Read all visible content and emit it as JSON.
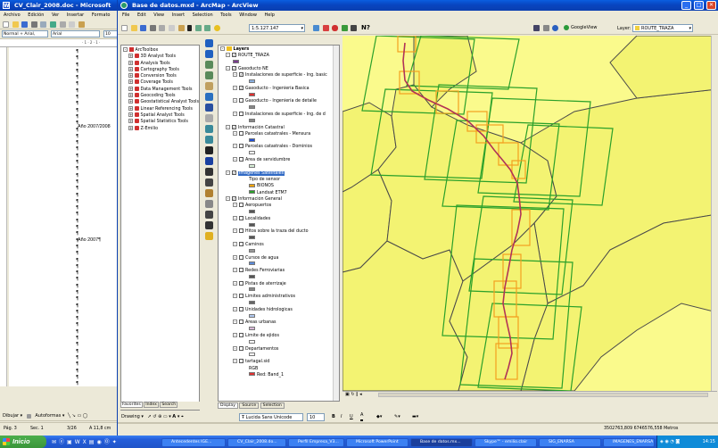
{
  "word": {
    "title": "CV_Clair_2008.doc - Microsoft Word",
    "menu": [
      "Archivo",
      "Edición",
      "Ver",
      "Insertar",
      "Formato"
    ],
    "style_box": "Normal + Arial,",
    "font_box": "Arial",
    "size_box": "10",
    "doc_text": [
      "Año 2007/2008",
      "Año 2007¶"
    ],
    "status": [
      "Pág. 3",
      "Sec. 1",
      "3/26",
      "A 11,8 cm"
    ],
    "draw_label": "Dibujar ▾",
    "autoshapes_label": "Autoformas ▾",
    "ruler_text": "· 1 · 2 · 1 ·"
  },
  "arcmap": {
    "title": "Base de datos.mxd - ArcMap - ArcView",
    "menu": [
      "File",
      "Edit",
      "View",
      "Insert",
      "Selection",
      "Tools",
      "Window",
      "Help"
    ],
    "scale": "1:5.127.147",
    "googleview": "GoogleView",
    "layer_label": "Layer:",
    "layer_value": "ROUTE_TRAZA",
    "toolbox": {
      "root": "ArcToolbox",
      "items": [
        "3D Analyst Tools",
        "Analysis Tools",
        "Cartography Tools",
        "Conversion Tools",
        "Coverage Tools",
        "Data Management Tools",
        "Geocoding Tools",
        "Geostatistical Analyst Tools",
        "Linear Referencing Tools",
        "Spatial Analyst Tools",
        "Spatial Statistics Tools",
        "Z-Emilio"
      ],
      "tabs": [
        "Favorites",
        "Index",
        "Search"
      ]
    },
    "toc": {
      "root": "Layers",
      "rows": [
        {
          "t": "ROUTE_TRAZA",
          "lvl": 1,
          "cb": true,
          "pm": "-"
        },
        {
          "t": "",
          "lvl": 2,
          "sw": "#7a3b8f"
        },
        {
          "t": "Gasoducto NE",
          "lvl": 1,
          "cb": true,
          "pm": "-"
        },
        {
          "t": "Instalaciones de superficie - Ing. basic",
          "lvl": 2,
          "cb": true,
          "pm": "-"
        },
        {
          "t": "",
          "lvl": 3,
          "sw": "#8ab0e0"
        },
        {
          "t": "Gasoducto - Ingeniería Basica",
          "lvl": 2,
          "cb": true,
          "pm": "-"
        },
        {
          "t": "",
          "lvl": 3,
          "sw": "#e03030"
        },
        {
          "t": "Gasoducto - Ingeniería de detalle",
          "lvl": 2,
          "cb": false,
          "pm": "-"
        },
        {
          "t": "",
          "lvl": 3,
          "sw": "#888888"
        },
        {
          "t": "Instalaciones de superficie - Ing. de d",
          "lvl": 2,
          "cb": false,
          "pm": "-"
        },
        {
          "t": "",
          "lvl": 3,
          "sw": "#888888"
        },
        {
          "t": "Información Catastral",
          "lvl": 1,
          "cb": true,
          "pm": "-"
        },
        {
          "t": "Parcelas catastrales - Mensura",
          "lvl": 2,
          "cb": false,
          "pm": "-"
        },
        {
          "t": "",
          "lvl": 3,
          "sw": "#1f4fd6"
        },
        {
          "t": "Parcelas catastrales - Dominios",
          "lvl": 2,
          "cb": false,
          "pm": "-"
        },
        {
          "t": "",
          "lvl": 3,
          "sw": "#ffffff"
        },
        {
          "t": "Area de servidumbre",
          "lvl": 2,
          "cb": false,
          "pm": "-"
        },
        {
          "t": "",
          "lvl": 3,
          "sw": "#d8f0d8"
        },
        {
          "t": "Imágenes Satelitales",
          "lvl": 1,
          "cb": true,
          "pm": "-",
          "sel": true
        },
        {
          "t": "Tipo de sensor",
          "lvl": 3
        },
        {
          "t": "BIONOS",
          "lvl": 3,
          "sw": "#ffa500"
        },
        {
          "t": "Landsat ETM7",
          "lvl": 3,
          "sw": "#2aa02a"
        },
        {
          "t": "Información General",
          "lvl": 1,
          "cb": true,
          "pm": "-"
        },
        {
          "t": "Aeropuertos",
          "lvl": 2,
          "cb": false,
          "pm": "-"
        },
        {
          "t": "",
          "lvl": 3,
          "sw": "#555555"
        },
        {
          "t": "Localidades",
          "lvl": 2,
          "cb": false,
          "pm": "-"
        },
        {
          "t": "",
          "lvl": 3,
          "sw": "#555555"
        },
        {
          "t": "Hitos sobre la traza del ducto",
          "lvl": 2,
          "cb": false,
          "pm": "-"
        },
        {
          "t": "",
          "lvl": 3,
          "sw": "#555555"
        },
        {
          "t": "Caminos",
          "lvl": 2,
          "cb": false,
          "pm": "-"
        },
        {
          "t": "",
          "lvl": 3,
          "sw": "#999999"
        },
        {
          "t": "Cursos de agua",
          "lvl": 2,
          "cb": false,
          "pm": "-"
        },
        {
          "t": "",
          "lvl": 3,
          "sw": "#5a8ad8"
        },
        {
          "t": "Redes Ferroviarias",
          "lvl": 2,
          "cb": false,
          "pm": "-"
        },
        {
          "t": "",
          "lvl": 3,
          "sw": "#555555"
        },
        {
          "t": "Pistas de aterrizaje",
          "lvl": 2,
          "cb": false,
          "pm": "-"
        },
        {
          "t": "",
          "lvl": 3,
          "sw": "#888888"
        },
        {
          "t": "Limites administrativos",
          "lvl": 2,
          "cb": false,
          "pm": "-"
        },
        {
          "t": "",
          "lvl": 3,
          "sw": "#666666"
        },
        {
          "t": "Unidades hidrologicas",
          "lvl": 2,
          "cb": false,
          "pm": "-"
        },
        {
          "t": "",
          "lvl": 3,
          "sw": "#b0c8f0"
        },
        {
          "t": "Areas urbanas",
          "lvl": 2,
          "cb": false,
          "pm": "-"
        },
        {
          "t": "",
          "lvl": 3,
          "sw": "#d8b8d8"
        },
        {
          "t": "Limite de ejidos",
          "lvl": 2,
          "cb": false,
          "pm": "-"
        },
        {
          "t": "",
          "lvl": 3,
          "sw": "#ffffff"
        },
        {
          "t": "Departamentos",
          "lvl": 2,
          "cb": false,
          "pm": "-"
        },
        {
          "t": "",
          "lvl": 3,
          "sw": "#ffffff"
        },
        {
          "t": "tartagal.sid",
          "lvl": 2,
          "cb": false,
          "pm": "-"
        },
        {
          "t": "RGB",
          "lvl": 3
        },
        {
          "t": "Red: Band_1",
          "lvl": 3,
          "sw": "#e03030"
        }
      ],
      "tabs": [
        "Display",
        "Source",
        "Selection"
      ]
    },
    "draw_bar": {
      "drawing": "Drawing ▾",
      "font": "Lucida Sans Unicode",
      "size": "10",
      "b": "B",
      "i": "I",
      "u": "U",
      "a": "A"
    },
    "coords": "3502763,809  6746576,558 Metros",
    "colors": {
      "map_bg": "#fafa8c",
      "polygon": "#f3f372",
      "border": "#4a4a4a",
      "landsat": "#2aa02a",
      "bionos": "#f3a020",
      "route": "#d83030"
    }
  },
  "taskbar": {
    "start": "Inicio",
    "buttons": [
      "Antecedentes IGE...",
      "CV_Clair_2008.do...",
      "Perfil Empresa_V3...",
      "Microsoft PowerPoint",
      "Base de datos.mx...",
      "Skype™ - emilio.clair",
      "SIG_ENARSA",
      "IMAGENES_ENARSA"
    ],
    "clock": "14:15"
  }
}
